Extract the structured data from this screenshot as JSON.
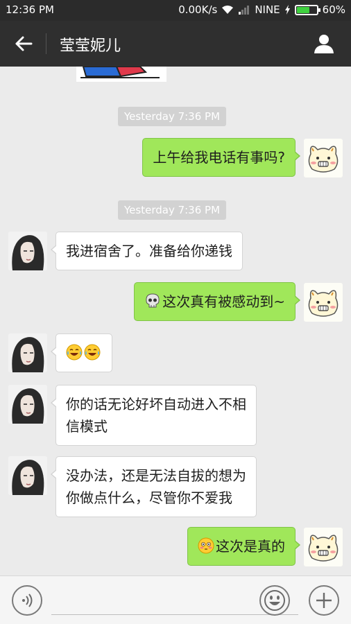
{
  "status_bar": {
    "time": "12:36 PM",
    "network_speed": "0.00K/s",
    "carrier": "NINE",
    "battery_percent": "60%",
    "battery_level": 0.6
  },
  "header": {
    "title": "莹莹妮儿",
    "back_icon": "arrow-left-icon",
    "profile_icon": "person-icon"
  },
  "messages": [
    {
      "type": "timestamp",
      "text": "Yesterday 7:36 PM"
    },
    {
      "type": "outgoing",
      "text": "上午给我电话有事吗?"
    },
    {
      "type": "timestamp",
      "text": "Yesterday 7:36 PM"
    },
    {
      "type": "incoming",
      "text": "我进宿舍了。准备给你递钱"
    },
    {
      "type": "outgoing",
      "emoji": "skull",
      "text": "这次真有被感动到~"
    },
    {
      "type": "incoming",
      "emoji": "tears-of-joy x2",
      "text": ""
    },
    {
      "type": "incoming",
      "lines": [
        "你的话无论好坏自动进入不相",
        "信模式"
      ]
    },
    {
      "type": "incoming",
      "lines": [
        "没办法，还是无法自拔的想为",
        "你做点什么，尽管你不爱我"
      ]
    },
    {
      "type": "outgoing",
      "emoji": "flushed-face",
      "text": "这次是真的"
    }
  ],
  "input_bar": {
    "placeholder": "",
    "voice_icon": "voice-icon",
    "emoji_icon": "smiley-icon",
    "plus_icon": "plus-icon"
  },
  "colors": {
    "outgoing_bubble": "#a0e75a",
    "incoming_bubble": "#ffffff",
    "header_bg": "#2f2f2f",
    "chat_bg": "#ebebeb"
  }
}
